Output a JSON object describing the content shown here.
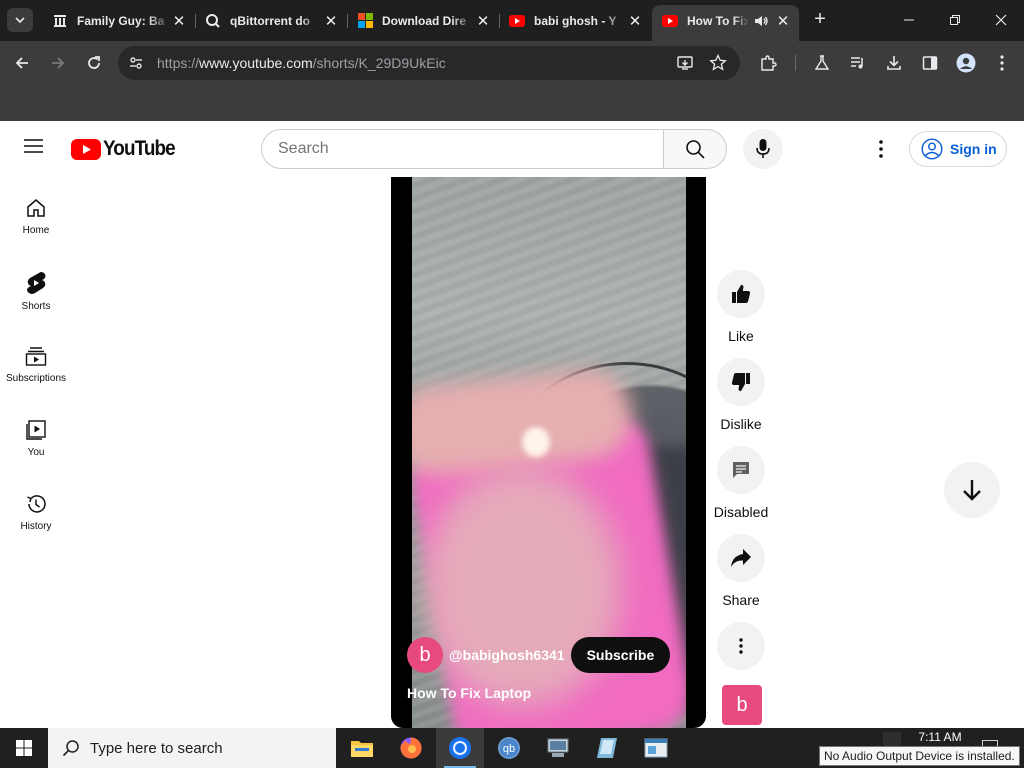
{
  "browser": {
    "tabs": [
      {
        "title": "Family Guy: Ba",
        "favicon": "archive-icon",
        "active": false
      },
      {
        "title": "qBittorrent do",
        "favicon": "qbittorrent-icon",
        "active": false
      },
      {
        "title": "Download Dire",
        "favicon": "microsoft-icon",
        "active": false
      },
      {
        "title": "babi ghosh - Y",
        "favicon": "youtube-icon",
        "active": false
      },
      {
        "title": "How To Fix",
        "favicon": "youtube-icon",
        "active": true,
        "audio": true
      }
    ],
    "close_glyph": "✕",
    "new_tab_glyph": "+",
    "url_prefix": "https://",
    "url_host": "www.youtube.com",
    "url_path": "/shorts/K_29D9UkEic"
  },
  "youtube": {
    "logo_text": "YouTube",
    "search_placeholder": "Search",
    "sign_in_label": "Sign in",
    "sidebar": [
      {
        "label": "Home",
        "icon": "home-icon"
      },
      {
        "label": "Shorts",
        "icon": "shorts-icon"
      },
      {
        "label": "Subscriptions",
        "icon": "subscriptions-icon"
      },
      {
        "label": "You",
        "icon": "you-icon"
      },
      {
        "label": "History",
        "icon": "history-icon"
      }
    ],
    "short": {
      "channel_initial": "b",
      "channel_handle": "@babighosh6341",
      "subscribe_label": "Subscribe",
      "title": "How To Fix Laptop"
    },
    "actions": [
      {
        "label": "Like",
        "icon": "thumbs-up-icon"
      },
      {
        "label": "Dislike",
        "icon": "thumbs-down-icon"
      },
      {
        "label": "Disabled",
        "icon": "comments-icon"
      },
      {
        "label": "Share",
        "icon": "share-icon"
      },
      {
        "label": "",
        "icon": "more-icon"
      }
    ],
    "colors": {
      "brand_red": "#ff0000",
      "link_blue": "#065fd4",
      "avatar_pink": "#e8497f"
    }
  },
  "taskbar": {
    "search_placeholder": "Type here to search",
    "time": "7:11 AM",
    "tooltip": "No Audio Output Device is installed."
  }
}
